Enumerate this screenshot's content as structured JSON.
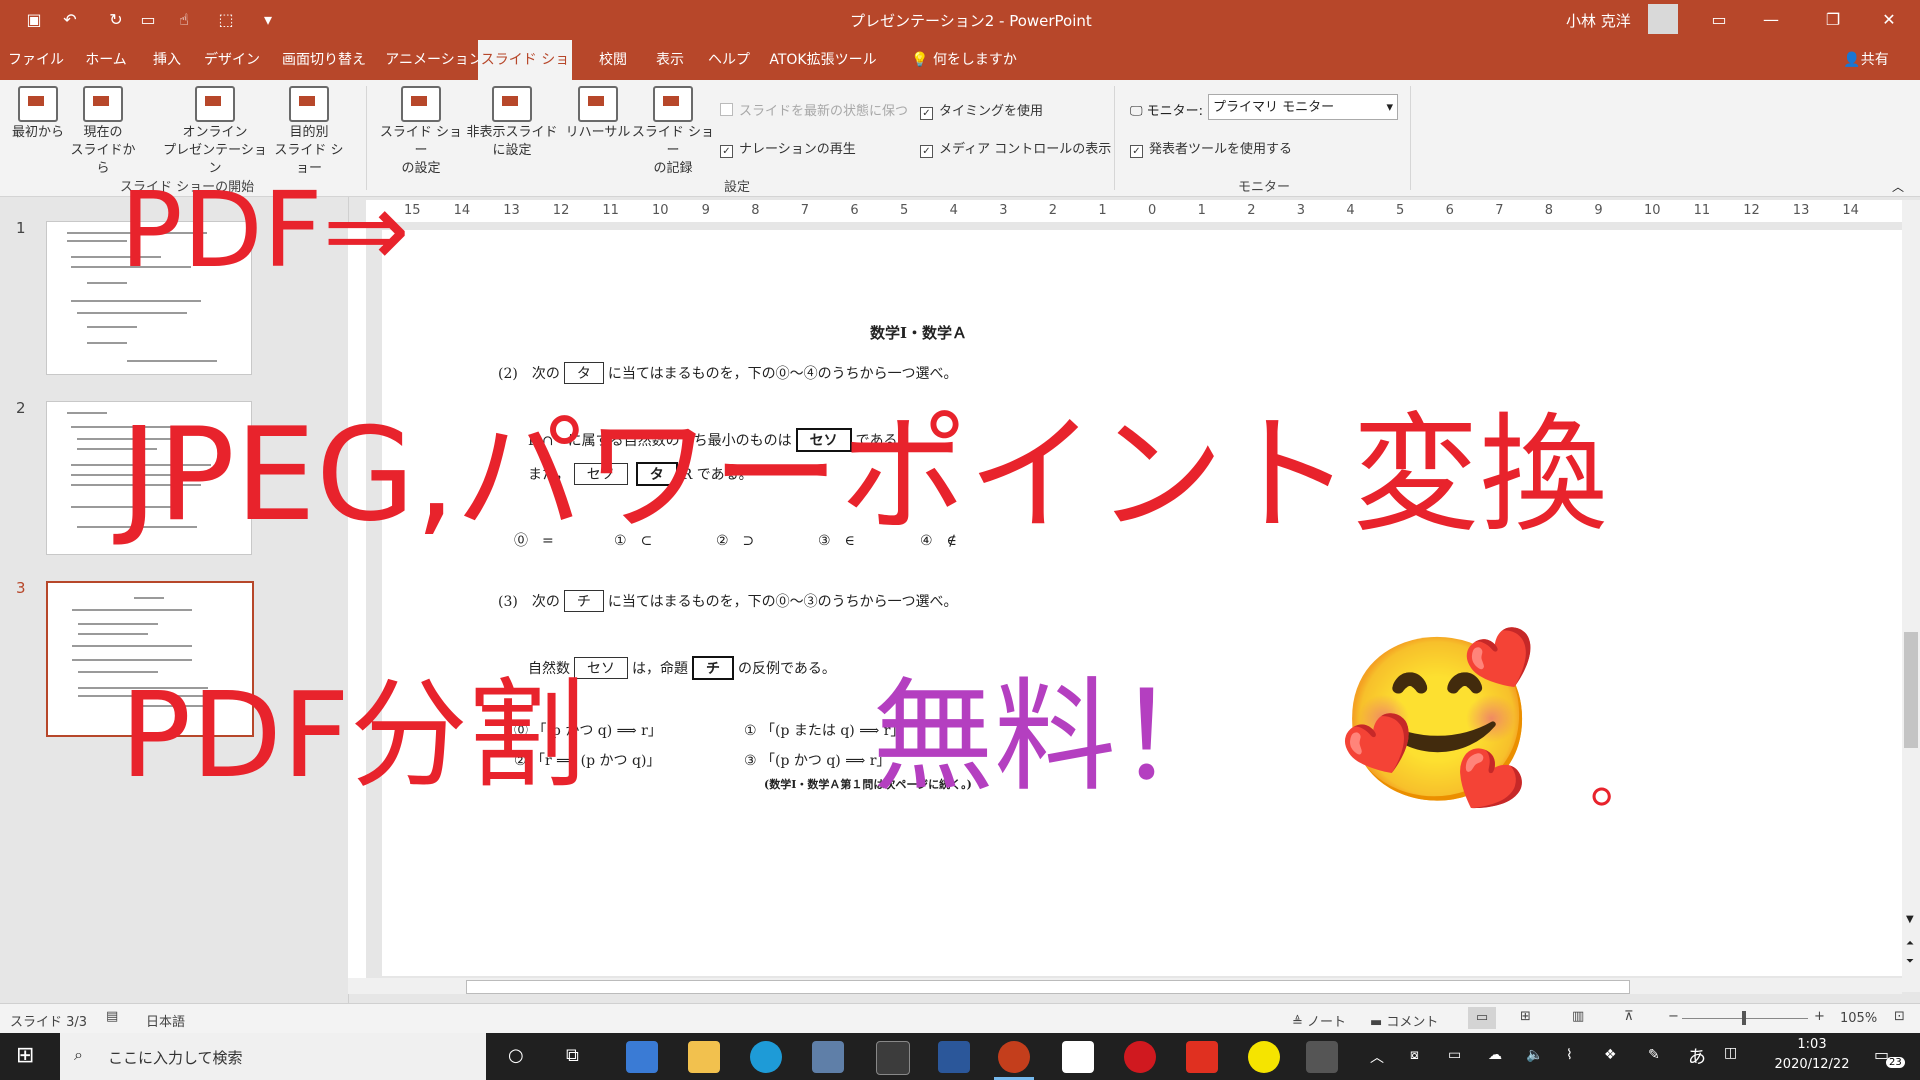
{
  "window": {
    "title": "プレゼンテーション2 - PowerPoint",
    "user": "小林 克洋"
  },
  "tabs": [
    "ファイル",
    "ホーム",
    "挿入",
    "デザイン",
    "画面切り替え",
    "アニメーション",
    "スライド ショー",
    "校閲",
    "表示",
    "ヘルプ",
    "ATOK拡張ツール"
  ],
  "tell_me": "何をしますか",
  "share": "共有",
  "ribbon": {
    "from_start": "最初から",
    "from_current": [
      "現在の",
      "スライドから"
    ],
    "online": [
      "オンライン",
      "プレゼンテーション"
    ],
    "custom": [
      "目的別",
      "スライド ショー"
    ],
    "group_start": "スライド ショーの開始",
    "setup": [
      "スライド ショー",
      "の設定"
    ],
    "hide": [
      "非表示スライド",
      "に設定"
    ],
    "rehearse": "リハーサル",
    "record": [
      "スライド ショー",
      "の記録"
    ],
    "keep_fresh": "スライドを最新の状態に保つ",
    "play_narration": "ナレーションの再生",
    "use_timings": "タイミングを使用",
    "media_controls": "メディア コントロールの表示",
    "group_setup": "設定",
    "monitor_label": "モニター:",
    "monitor_value": "プライマリ モニター",
    "presenter_view": "発表者ツールを使用する",
    "group_monitor": "モニター"
  },
  "thumbnails": [
    "1",
    "2",
    "3"
  ],
  "slide": {
    "title": "数学Ⅰ・数学Ａ",
    "q2_prefix": "(2)　次の",
    "q2_box": "タ",
    "q2_suffix": "に当てはまるものを，下の⓪～④のうちから一つ選べ。",
    "line_a": "P ∩",
    "line_a2": "に属する自然数のうち最小のものは",
    "box_seso": "セソ",
    "line_a_end": "である。",
    "line_b": "また，",
    "box_ta": "タ",
    "line_b_end": "R である。",
    "choices_q2": [
      "⓪　=",
      "①　⊂",
      "②　⊃",
      "③　∈",
      "④　∉"
    ],
    "q3_prefix": "(3)　次の",
    "q3_box": "チ",
    "q3_suffix": "に当てはまるものを，下の⓪～③のうちから一つ選べ。",
    "line_c": "自然数",
    "box_seso2": "セソ",
    "line_c2": "は，命題",
    "box_chi": "チ",
    "line_c_end": "の反例である。",
    "choice_0": "⓪ 「(p かつ q) ⟹ r」",
    "choice_1": "① 「(p または q) ⟹ r」",
    "choice_2": "② 「r ⟹ (p かつ q)」",
    "choice_3": "③ 「(p かつ q) ⟹ r」",
    "footer": "(数学Ⅰ・数学Ａ第１問は次ページに続く。)"
  },
  "ruler_numbers": [
    "15",
    "14",
    "13",
    "12",
    "11",
    "10",
    "9",
    "8",
    "7",
    "6",
    "5",
    "4",
    "3",
    "2",
    "1",
    "0",
    "1",
    "2",
    "3",
    "4",
    "5",
    "6",
    "7",
    "8",
    "9",
    "10",
    "11",
    "12",
    "13",
    "14"
  ],
  "overlay": {
    "line1": "PDF⇒",
    "line2": "JPEG,パワーポイント変換",
    "line3a": "PDF分割",
    "line3b": "無料！",
    "emoji": "🥰",
    "period": "。"
  },
  "status": {
    "slide": "スライド 3/3",
    "language": "日本語",
    "notes": "ノート",
    "comments": "コメント",
    "zoom": "105%"
  },
  "taskbar": {
    "search_placeholder": "ここに入力して検索",
    "time": "1:03",
    "date": "2020/12/22",
    "badge": "23",
    "ime": "あ"
  },
  "colors": {
    "accent": "#b7472a",
    "overlay_red": "#e8232c",
    "overlay_purple": "#b43fc0"
  }
}
